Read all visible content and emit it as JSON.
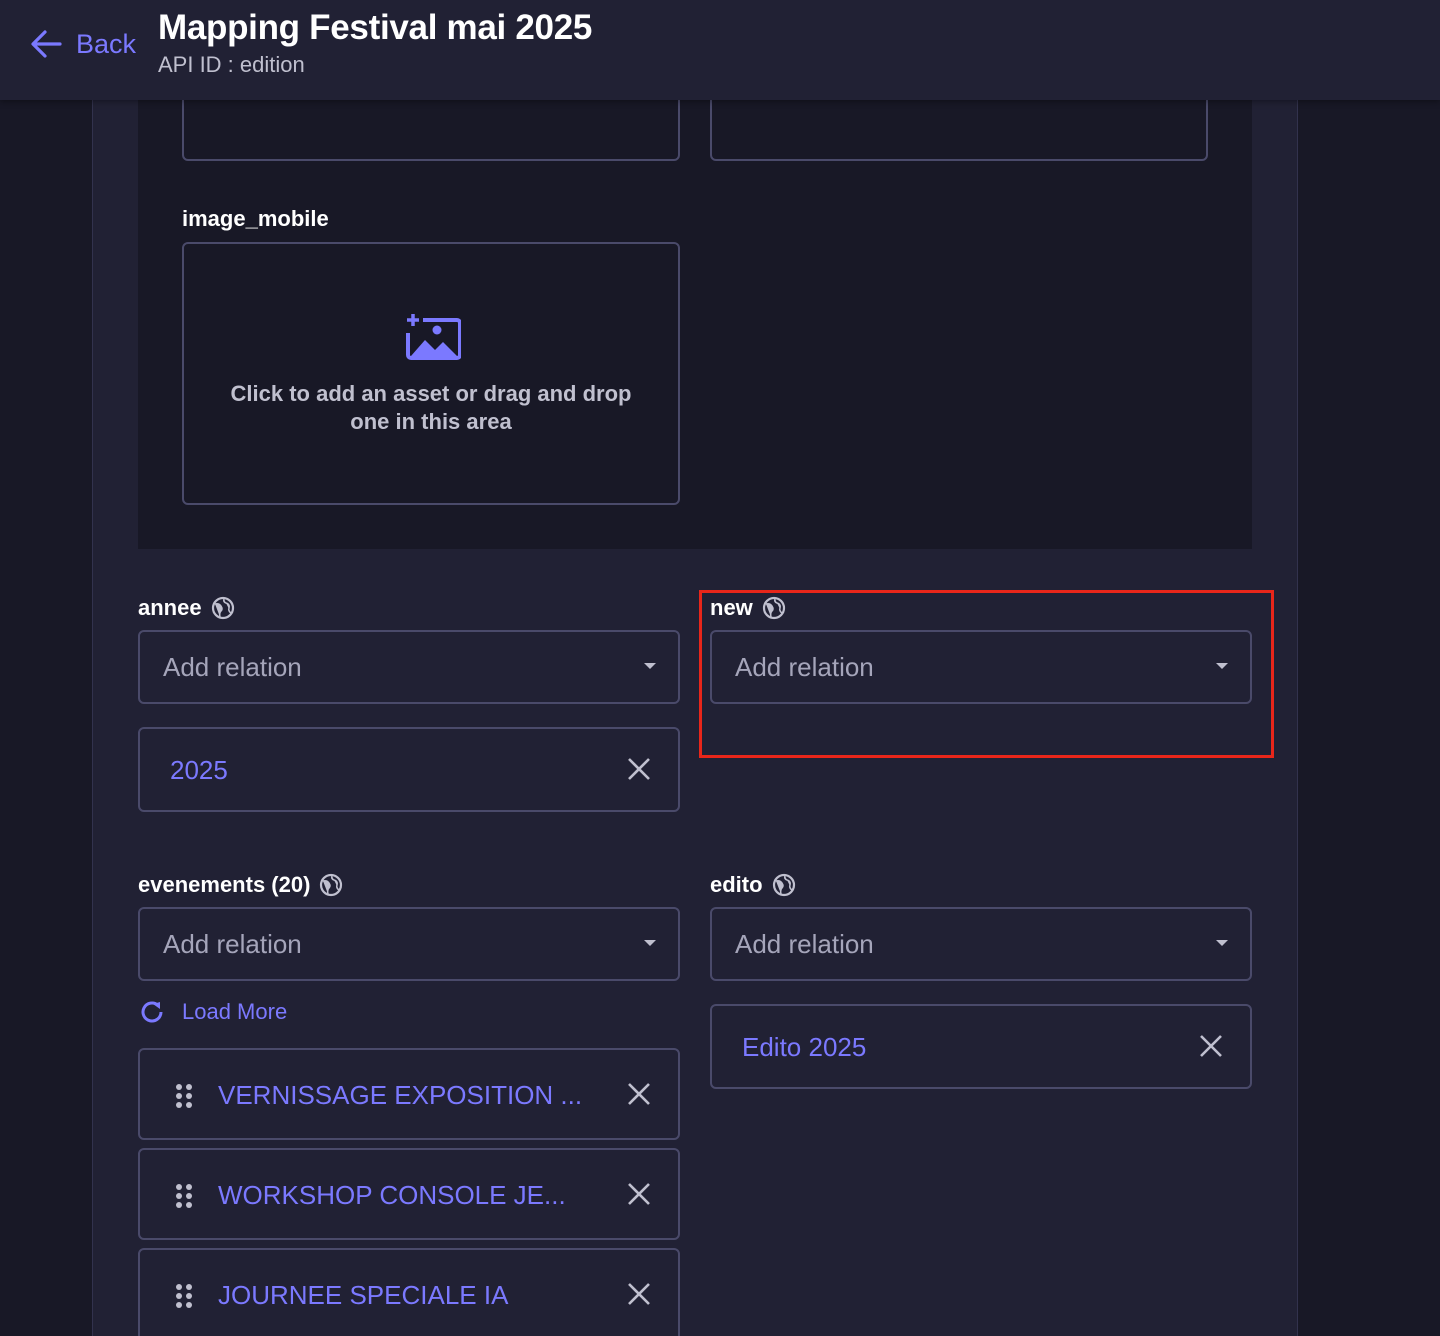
{
  "header": {
    "back_label": "Back",
    "title": "Mapping Festival mai 2025",
    "subtitle": "API ID : edition"
  },
  "image_mobile": {
    "label": "image_mobile",
    "placeholder": "Click to add an asset or drag and drop one in this area"
  },
  "fields": {
    "annee": {
      "label": "annee",
      "select_placeholder": "Add relation",
      "selected": "2025"
    },
    "new": {
      "label": "new",
      "select_placeholder": "Add relation"
    },
    "evenements": {
      "label": "evenements (20)",
      "select_placeholder": "Add relation",
      "load_more": "Load More",
      "items": [
        "VERNISSAGE EXPOSITION ...",
        "WORKSHOP CONSOLE JE...",
        "JOURNEE SPECIALE IA"
      ]
    },
    "edito": {
      "label": "edito",
      "select_placeholder": "Add relation",
      "selected": "Edito 2025"
    }
  },
  "colors": {
    "accent": "#7b79ff",
    "highlight": "#e8261a",
    "background": "#181826",
    "surface": "#212134",
    "border": "#4a4a6a"
  },
  "icons": {
    "back": "arrow-left-icon",
    "asset": "image-plus-icon",
    "i18n": "globe-icon",
    "load_more": "refresh-icon",
    "drag": "drag-handle-icon",
    "remove": "close-icon",
    "dropdown": "caret-down-icon"
  }
}
